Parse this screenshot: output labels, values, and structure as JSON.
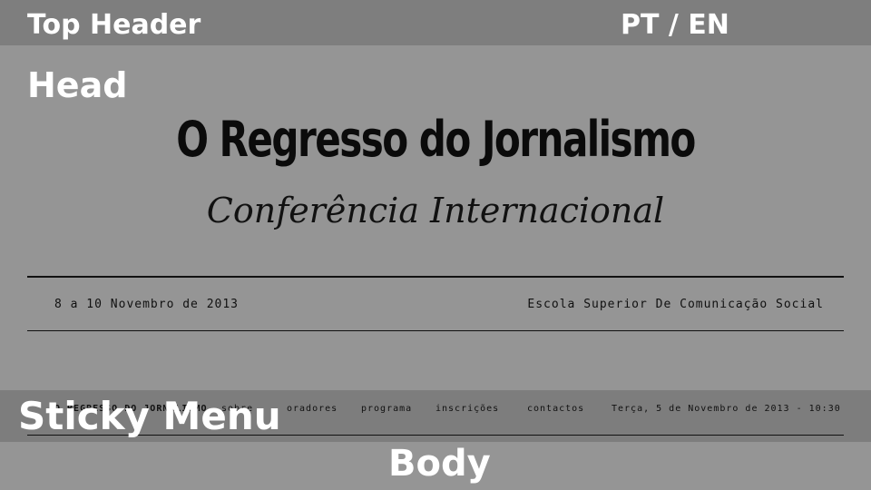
{
  "overlay_labels": {
    "top_header": "Top Header",
    "language": "PT / EN",
    "head": "Head",
    "sticky_menu": "Sticky Menu",
    "body": "Body"
  },
  "header": {
    "title": "O Regresso do Jornalismo",
    "subtitle": "Conferência Internacional"
  },
  "info_bar": {
    "dates": "8 a 10 Novembro de 2013",
    "venue": "Escola Superior De Comunicação Social"
  },
  "menu": {
    "brand": "O Regresso do Jornalismo",
    "items": [
      {
        "label": "sobre"
      },
      {
        "label": "oradores"
      },
      {
        "label": "programa"
      },
      {
        "label": "inscrições"
      },
      {
        "label": "contactos"
      }
    ],
    "datetime": "Terça, 5 de Novembro de 2013 - 10:30"
  },
  "colors": {
    "background": "#959595",
    "header_band": "#7e7e7e",
    "text": "#111111",
    "overlay_text": "#ffffff"
  }
}
